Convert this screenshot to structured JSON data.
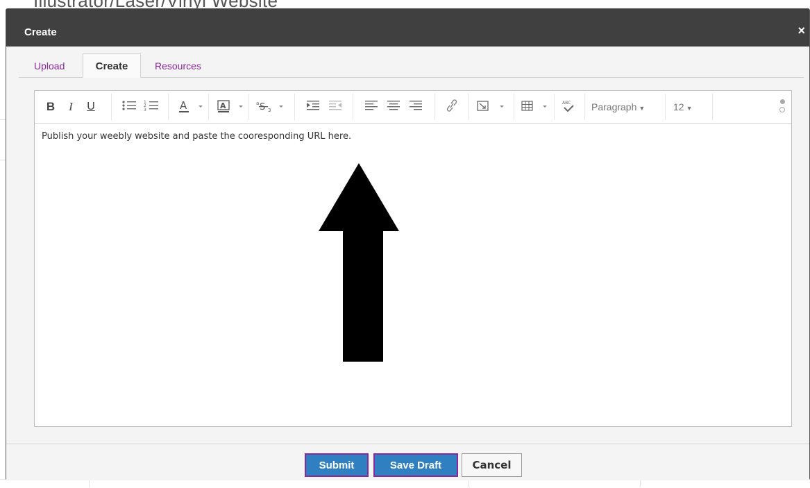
{
  "background": {
    "page_title": "Illustrator/Laser/Vinyl Website"
  },
  "modal": {
    "title": "Create",
    "close_glyph": "×",
    "tabs": [
      {
        "label": "Upload",
        "active": false
      },
      {
        "label": "Create",
        "active": true
      },
      {
        "label": "Resources",
        "active": false
      }
    ],
    "editor": {
      "toolbar": {
        "bold": "B",
        "italic": "I",
        "underline": "U",
        "paragraph_format": "Paragraph",
        "font_size": "12",
        "icons": [
          "bold-icon",
          "italic-icon",
          "underline-icon",
          "bullet-list-icon",
          "numbered-list-icon",
          "text-color-icon",
          "highlight-color-icon",
          "superscript-subscript-icon",
          "indent-icon",
          "outdent-icon",
          "align-left-icon",
          "align-center-icon",
          "align-right-icon",
          "link-icon",
          "insert-media-icon",
          "table-icon",
          "spellcheck-icon"
        ]
      },
      "content": "Publish your weebly website and paste the cooresponding URL here."
    },
    "footer": {
      "submit_label": "Submit",
      "save_draft_label": "Save Draft",
      "cancel_label": "Cancel"
    }
  },
  "colors": {
    "header_bg": "#404040",
    "tab_link": "#8a2a9a",
    "primary_button": "#2f7fc1",
    "button_border": "#8a2a9a",
    "annotation_arrow": "#000000"
  }
}
